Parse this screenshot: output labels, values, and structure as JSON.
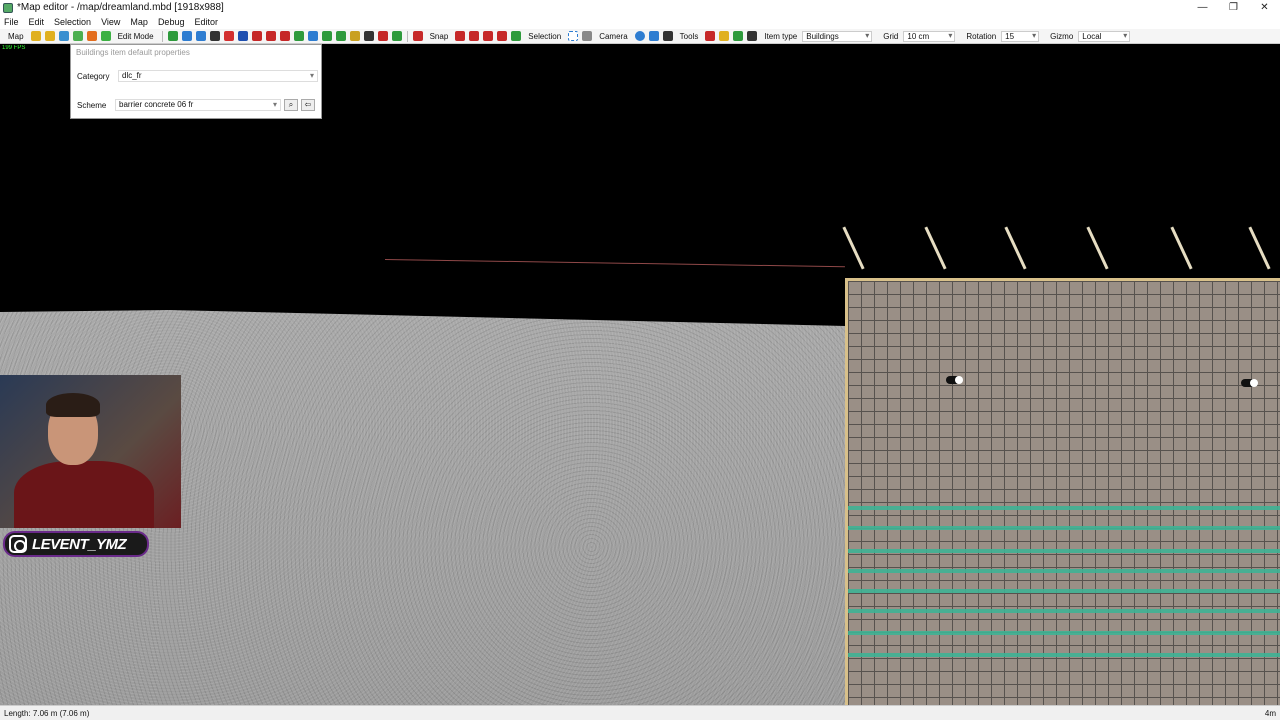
{
  "window": {
    "title": "*Map editor - /map/dreamland.mbd [1918x988]",
    "controls": [
      "—",
      "❐",
      "✕"
    ]
  },
  "menu": [
    "File",
    "Edit",
    "Selection",
    "View",
    "Map",
    "Debug",
    "Editor"
  ],
  "toolbar": {
    "map_label": "Map",
    "edit_mode_label": "Edit Mode",
    "snap_label": "Snap",
    "selection_label": "Selection",
    "camera_label": "Camera",
    "tools_label": "Tools",
    "item_type_label": "Item type",
    "item_type_value": "Buildings",
    "grid_label": "Grid",
    "grid_value": "10 cm",
    "rotation_label": "Rotation",
    "rotation_value": "15",
    "gizmo_label": "Gizmo",
    "gizmo_value": "Local",
    "icon_colors": [
      "#e0b020",
      "#e0b020",
      "#3a8fd0",
      "#4caf50",
      "#e36d1e",
      "#3cb043",
      "#2e7dd1",
      "#2e7dd1",
      "#333333",
      "#d32f2f",
      "#1e4fb0",
      "#c2185b",
      "#d32f2f",
      "#c62828",
      "#c62828",
      "#2e7dd1",
      "#2e7dd1",
      "#2e9a3c",
      "#2e9a3c",
      "#c9a020",
      "#333333",
      "#c62828",
      "#2e9a3c"
    ]
  },
  "overlay": {
    "header": "Buildings item default properties",
    "category_label": "Category",
    "category_value": "dlc_fr",
    "scheme_label": "Scheme",
    "scheme_value": "barrier concrete 06 fr"
  },
  "viewport": {
    "fps": "199 FPS"
  },
  "streamer": {
    "handle": "LEVENT_YMZ"
  },
  "status": {
    "left": "Length: 7.06 m (7.06 m)",
    "right": "4m"
  }
}
